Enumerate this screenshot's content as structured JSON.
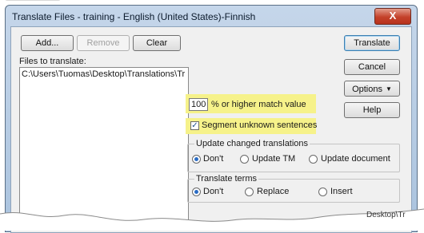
{
  "window": {
    "title": "Translate Files - training - English (United States)-Finnish",
    "close_label": "X"
  },
  "toolbar": {
    "add_label": "Add...",
    "remove_label": "Remove",
    "clear_label": "Clear"
  },
  "files": {
    "label": "Files to translate:",
    "items": [
      "C:\\Users\\Tuomas\\Desktop\\Translations\\Tr"
    ]
  },
  "actions": {
    "translate_label": "Translate",
    "cancel_label": "Cancel",
    "options_label": "Options",
    "help_label": "Help"
  },
  "match": {
    "value": "100",
    "suffix": "% or higher match value"
  },
  "segment_unknown": {
    "label": "Segment unknown sentences",
    "checked": true
  },
  "update_group": {
    "title": "Update changed translations",
    "options": [
      "Don't",
      "Update TM",
      "Update document"
    ],
    "selected": "Don't"
  },
  "terms_group": {
    "title": "Translate terms",
    "options": [
      "Don't",
      "Replace",
      "Insert"
    ],
    "selected": "Don't"
  },
  "bottom_fragment": "Desktop\\Tr"
}
